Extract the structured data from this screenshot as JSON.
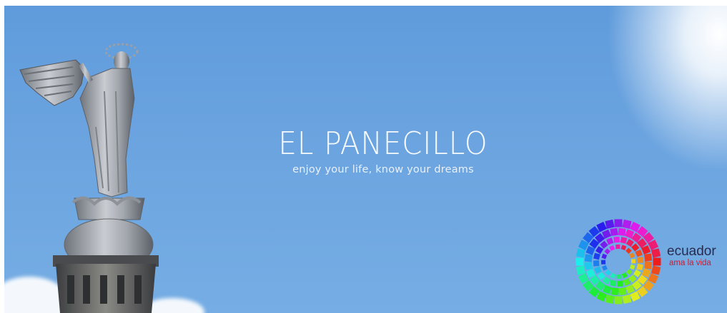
{
  "banner": {
    "title": "EL PANECILLO",
    "subtitle": "enjoy your life, know your dreams"
  },
  "logo": {
    "word": "ecuador",
    "tagline": "ama la vida",
    "icon": "ecuador-rainbow-mosaic-icon"
  },
  "colors": {
    "sky": "#6aa3df",
    "logo_word": "#2a2a4e",
    "logo_tag": "#d4182a"
  }
}
